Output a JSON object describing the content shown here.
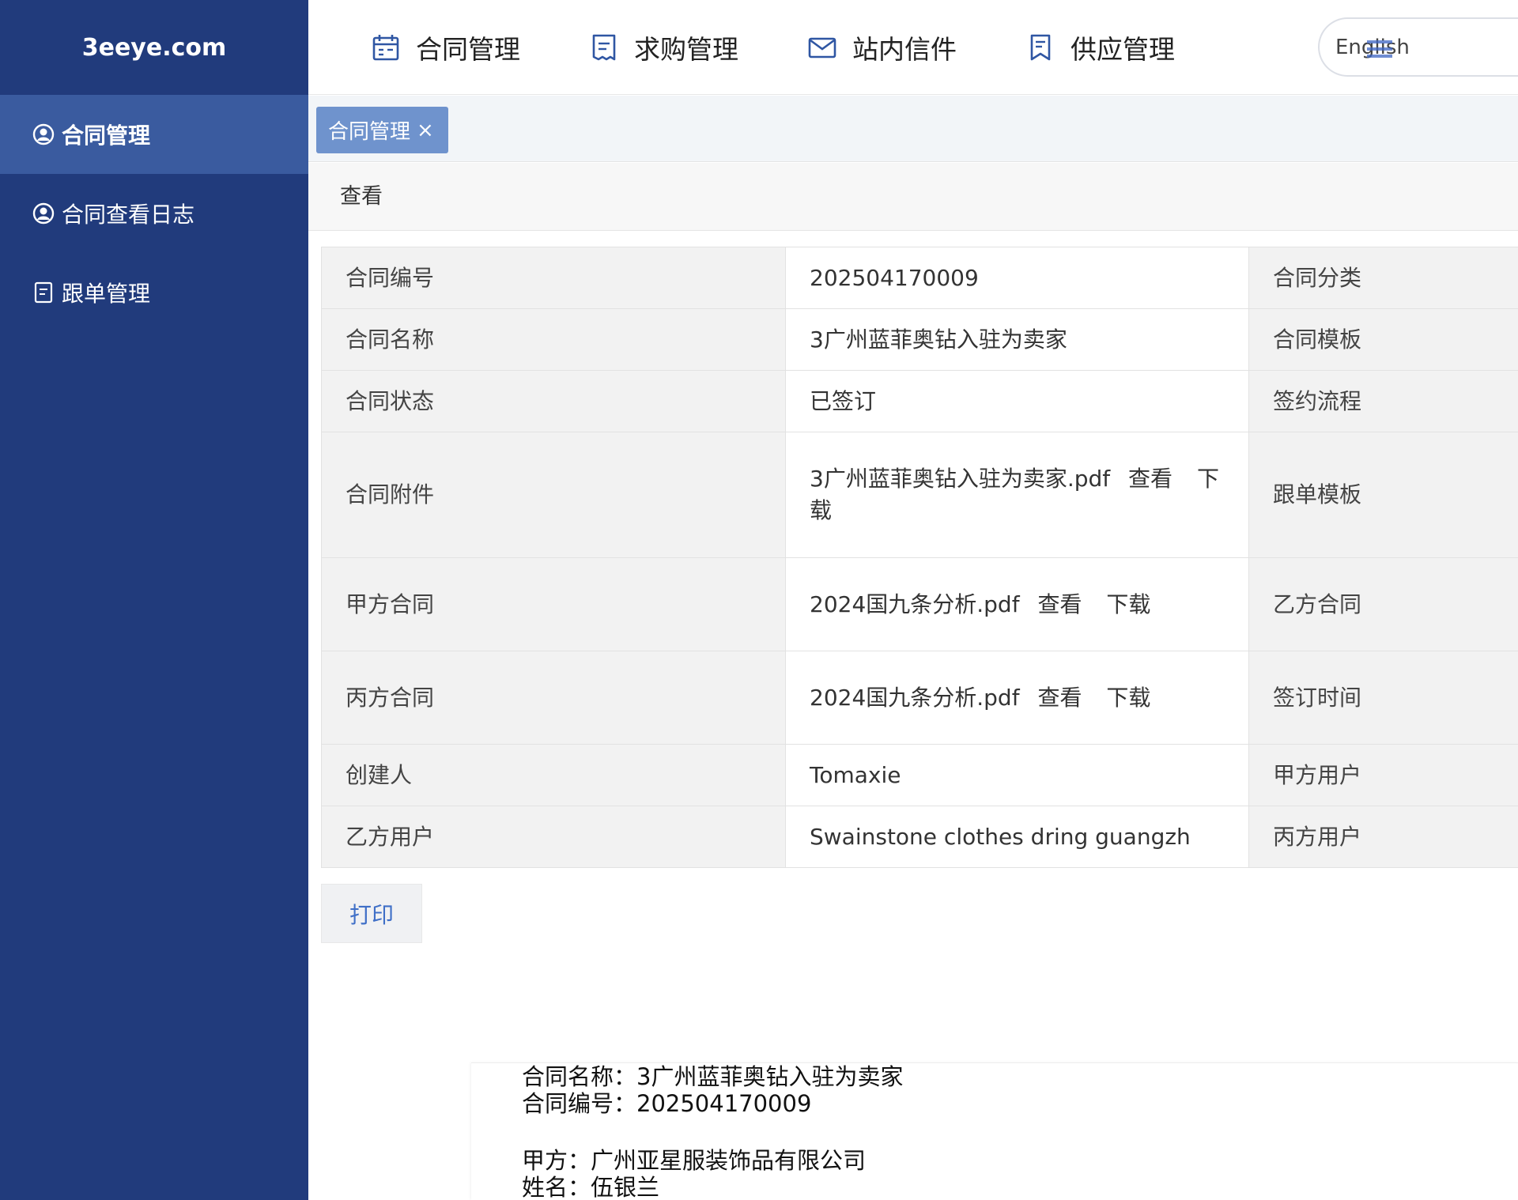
{
  "sidebar": {
    "logo": "3eeye.com",
    "items": [
      {
        "label": "合同管理",
        "icon": "user-circle-icon",
        "active": true
      },
      {
        "label": "合同查看日志",
        "icon": "user-circle-icon",
        "active": false
      },
      {
        "label": "跟单管理",
        "icon": "document-icon",
        "active": false
      }
    ]
  },
  "header": {
    "nav": [
      {
        "label": "合同管理",
        "icon": "calendar-icon"
      },
      {
        "label": "求购管理",
        "icon": "receipt-icon"
      },
      {
        "label": "站内信件",
        "icon": "envelope-icon"
      },
      {
        "label": "供应管理",
        "icon": "bookmark-doc-icon"
      }
    ],
    "language": "English"
  },
  "tabs": [
    {
      "label": "合同管理",
      "close": "×"
    }
  ],
  "breadcrumb": "查看",
  "detail": {
    "rows": [
      {
        "label1": "合同编号",
        "value1": "202504170009",
        "label2": "合同分类"
      },
      {
        "label1": "合同名称",
        "value1": "3广州蓝菲奥钻入驻为卖家",
        "label2": "合同模板"
      },
      {
        "label1": "合同状态",
        "value1": "已签订",
        "label2": "签约流程"
      },
      {
        "label1": "合同附件",
        "value1": "3广州蓝菲奥钻入驻为卖家.pdf",
        "label2": "跟单模板"
      },
      {
        "label1": "甲方合同",
        "value1": "2024国九条分析.pdf",
        "label2": "乙方合同"
      },
      {
        "label1": "丙方合同",
        "value1": "2024国九条分析.pdf",
        "label2": "签订时间"
      },
      {
        "label1": "创建人",
        "value1": "Tomaxie",
        "label2": "甲方用户"
      },
      {
        "label1": "乙方用户",
        "value1": "Swainstone clothes dring guangzh",
        "label2": "丙方用户"
      }
    ],
    "view_label": "查看",
    "download_label": "下载"
  },
  "print_button": "打印",
  "preview": {
    "lines": [
      "合同名称：3广州蓝菲奥钻入驻为卖家",
      "合同编号：202504170009",
      "甲方：广州亚星服装饰品有限公司",
      "姓名：伍银兰"
    ]
  }
}
